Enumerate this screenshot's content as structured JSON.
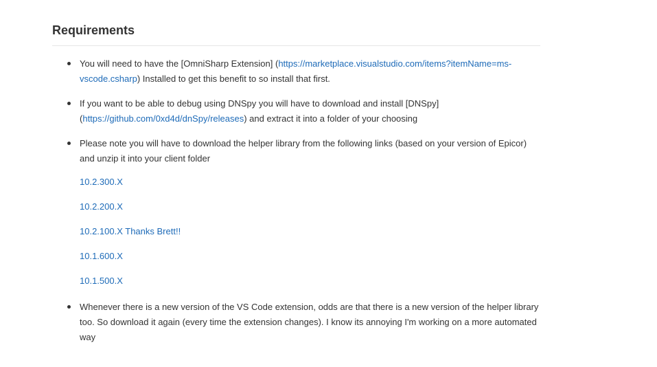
{
  "section": {
    "heading": "Requirements"
  },
  "items": [
    {
      "pre": "You will need to have the [OmniSharp Extension] (",
      "link": "https://marketplace.visualstudio.com/items?itemName=ms-vscode.csharp",
      "post": ") Installed to get this benefit to so install that first."
    },
    {
      "pre": "If you want to be able to debug using DNSpy you will have to download and install [DNSpy] (",
      "link": "https://github.com/0xd4d/dnSpy/releases",
      "post": ") and extract it into a folder of your choosing"
    },
    {
      "text": "Please note you will have to download the helper library from the following links (based on your version of Epicor) and unzip it into your client folder"
    },
    {
      "text": "Whenever there is a new version of the VS Code extension, odds are that there is a new version of the helper library too. So download it again (every time the extension changes). I know its annoying I'm working on a more automated way"
    }
  ],
  "version_links": [
    "10.2.300.X",
    "10.2.200.X",
    "10.2.100.X Thanks Brett!!",
    "10.1.600.X",
    "10.1.500.X"
  ],
  "colors": {
    "text": "#333333",
    "link": "#1e6bb8",
    "rule": "#e6e6e6"
  }
}
